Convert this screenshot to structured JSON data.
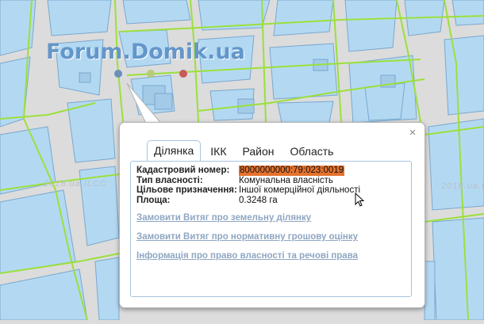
{
  "map": {
    "watermark": "Forum.Domik.ua",
    "faint_label": "2018.ua.ILCC",
    "colors": {
      "road": "#dcdcdc",
      "parcel_fill": "#b3d9f2",
      "parcel_stroke": "#7aa7cf",
      "boundary": "#9be03c",
      "marker_blue": "#6c8fb9",
      "marker_green": "#b6cc77",
      "marker_red": "#c95a5a"
    }
  },
  "popup": {
    "close_icon": "×",
    "tabs": [
      {
        "label": "Ділянка",
        "active": true
      },
      {
        "label": "ІКК",
        "active": false
      },
      {
        "label": "Район",
        "active": false
      },
      {
        "label": "Область",
        "active": false
      }
    ],
    "fields": [
      {
        "label": "Кадастровий номер:",
        "value": "8000000000:79:023:0019",
        "highlight": true
      },
      {
        "label": "Тип власності:",
        "value": "Комунальна власність",
        "highlight": false
      },
      {
        "label": "Цільове призначення:",
        "value": "Іншої комерційної діяльності",
        "highlight": false
      },
      {
        "label": "Площа:",
        "value": "0.3248 га",
        "highlight": false
      }
    ],
    "links": [
      "Замовити Витяг про земельну ділянку",
      "Замовити Витяг про нормативну грошову оцінку",
      "Інформація про право власності та речові права"
    ]
  }
}
